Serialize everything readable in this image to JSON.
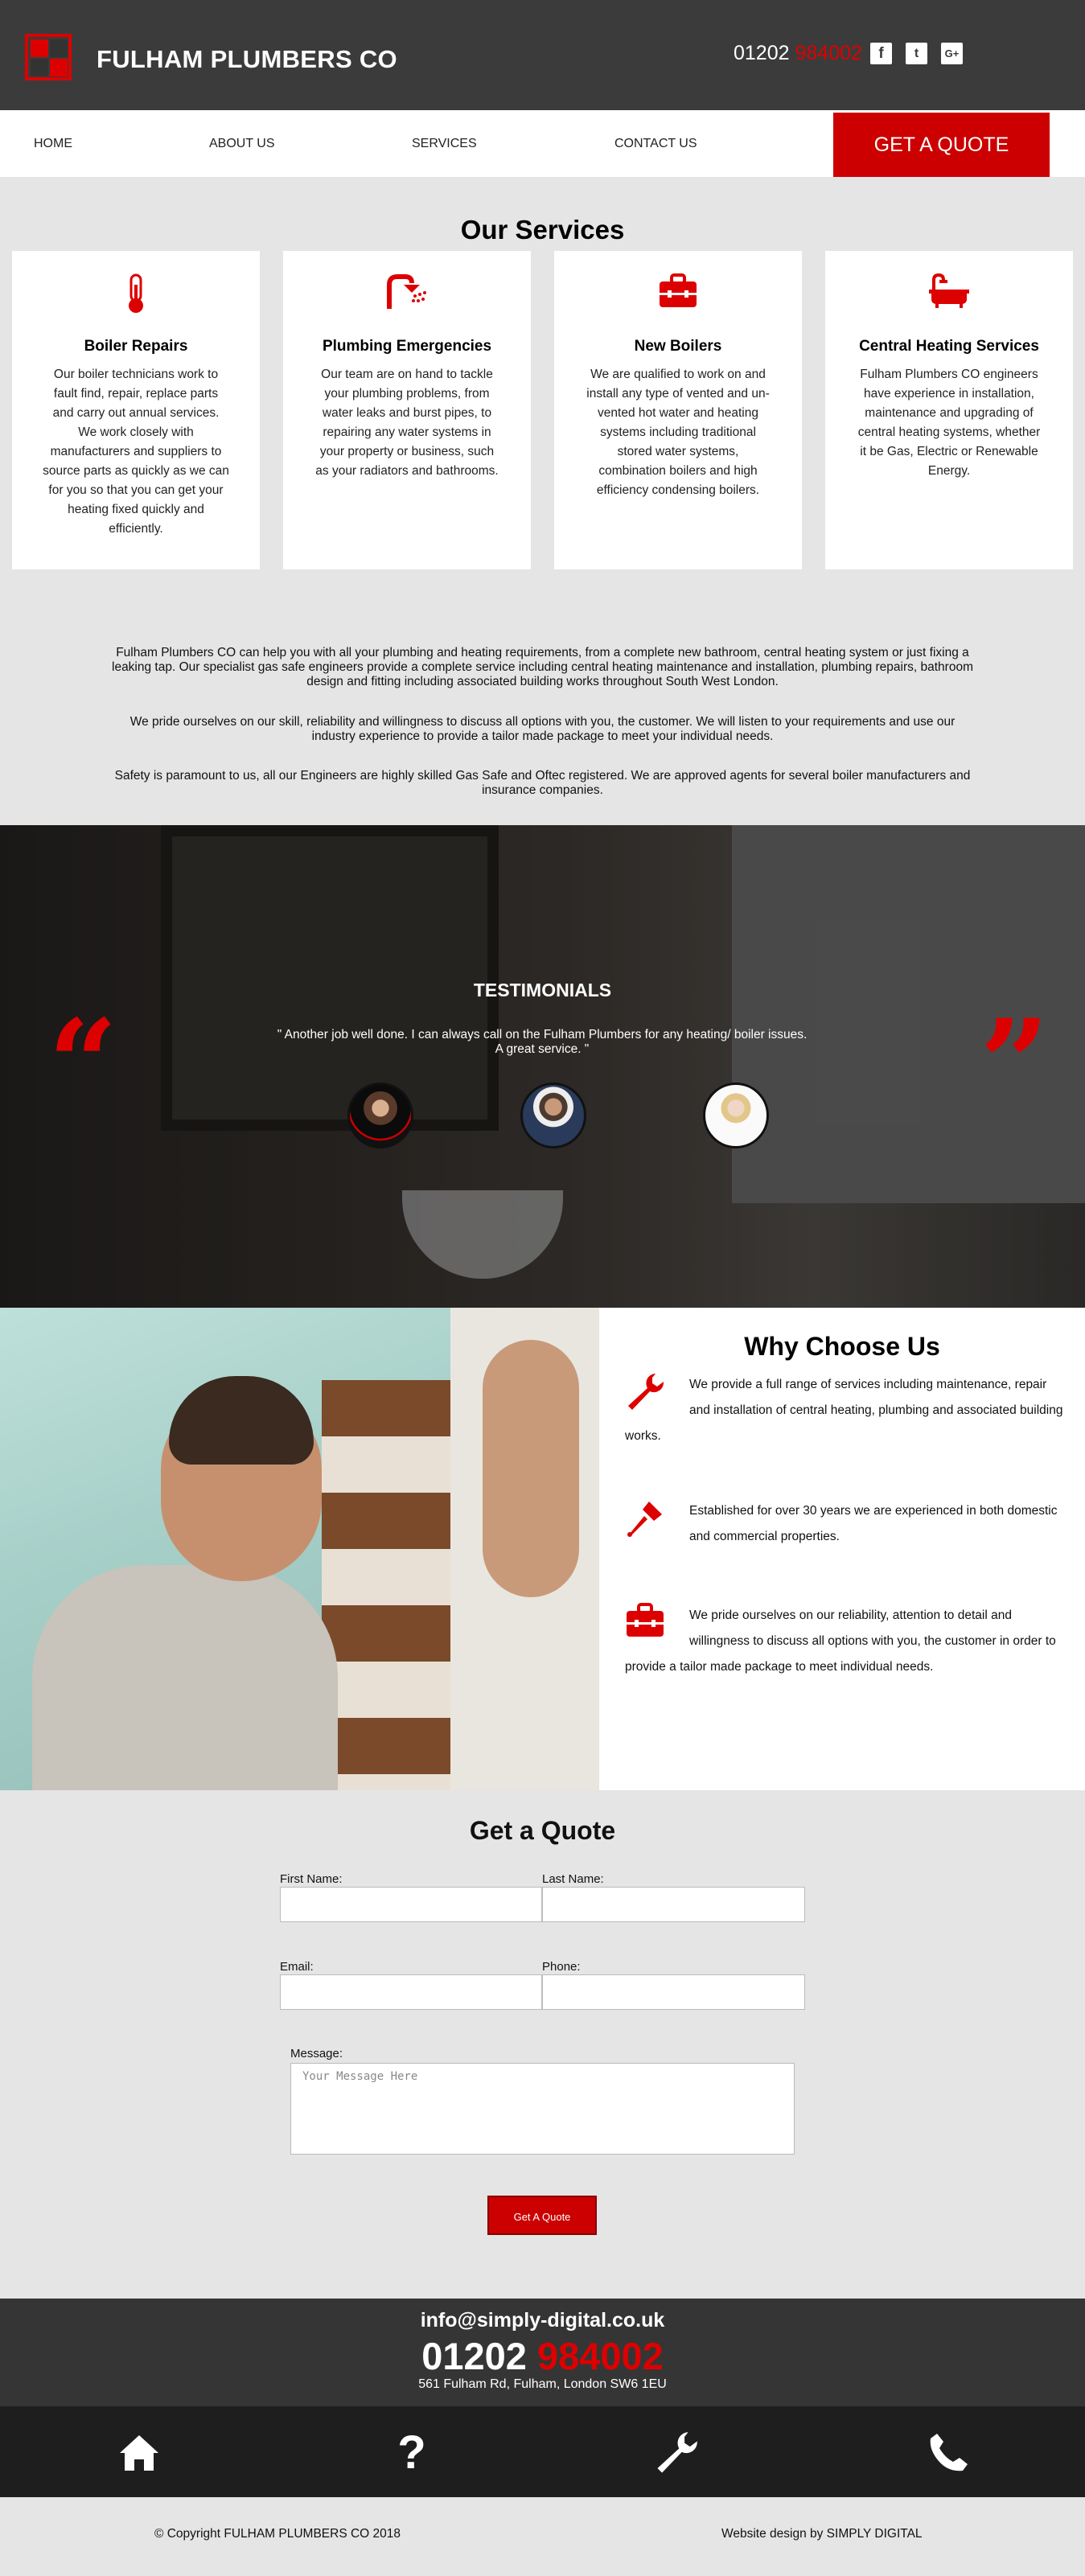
{
  "brand": {
    "name": "FULHAM PLUMBERS CO"
  },
  "header": {
    "phone_prefix": "01202",
    "phone_suffix": "984002",
    "social": [
      {
        "icon": "facebook-icon",
        "glyph": "f"
      },
      {
        "icon": "twitter-icon",
        "glyph": "t"
      },
      {
        "icon": "google-plus-icon",
        "glyph": "G+"
      }
    ]
  },
  "nav": {
    "items": [
      "HOME",
      "ABOUT US",
      "SERVICES",
      "CONTACT US"
    ],
    "cta": "GET A QUOTE"
  },
  "services": {
    "title": "Our Services",
    "cards": [
      {
        "icon": "thermometer-icon",
        "title": "Boiler Repairs",
        "text": "Our boiler technicians work to fault find, repair, replace parts and carry out annual services. We work closely with manufacturers and suppliers to source parts as quickly as we can for you so that you can get your heating fixed quickly and efficiently."
      },
      {
        "icon": "shower-icon",
        "title": "Plumbing Emergencies",
        "text": "Our team are on hand to tackle your plumbing problems, from water leaks and burst pipes, to repairing any water systems in your property or business, such as your radiators and bathrooms."
      },
      {
        "icon": "toolbox-icon",
        "title": "New Boilers",
        "text": "We are qualified to work on and install any type of vented and un-vented hot water and heating systems including traditional stored water systems, combination boilers and high efficiency condensing boilers."
      },
      {
        "icon": "bathtub-icon",
        "title": "Central Heating Services",
        "text": "Fulham Plumbers CO engineers have experience in installation, maintenance and upgrading of central heating systems, whether it be Gas, Electric or Renewable Energy."
      }
    ]
  },
  "intro": [
    "Fulham Plumbers CO can help you with all your plumbing and heating requirements, from a complete new bathroom, central heating system or just fixing a leaking tap. Our specialist gas safe engineers provide a complete service including central heating maintenance and installation, plumbing repairs, bathroom design and fitting including associated building works throughout South West London.",
    "We pride ourselves on our skill, reliability and willingness to discuss all options with you, the customer. We will listen to your requirements and use our industry experience to provide a tailor made package to meet your individual needs.",
    "Safety is paramount to us, all our Engineers are highly skilled Gas Safe and Oftec registered. We are approved agents for several boiler manufacturers and insurance companies."
  ],
  "testimonials": {
    "title": "TESTIMONIALS",
    "quote": "\" Another job well done. I can always call on the Fulham Plumbers for any heating/ boiler issues. A great service. \"",
    "avatars": [
      "avatar-woman-dark",
      "avatar-man-beard",
      "avatar-woman-blonde"
    ]
  },
  "why": {
    "title": "Why Choose Us",
    "items": [
      {
        "icon": "wrench-icon",
        "text": "We provide a full range of services including maintenance, repair and installation of central heating, plumbing and associated building works."
      },
      {
        "icon": "screwdriver-icon",
        "text": "Established for over 30 years we are experienced in both domestic and commercial properties."
      },
      {
        "icon": "toolbox-icon",
        "text": "We pride ourselves on our reliability, attention to detail and willingness to discuss all options with you, the customer in order to provide a tailor made package to meet individual needs."
      }
    ]
  },
  "form": {
    "title": "Get a Quote",
    "first_name_label": "First Name:",
    "last_name_label": "Last Name:",
    "email_label": "Email:",
    "phone_label": "Phone:",
    "message_label": "Message:",
    "message_placeholder": "Your Message Here",
    "submit_label": "Get A Quote"
  },
  "footer": {
    "email": "info@simply-digital.co.uk",
    "phone_prefix": "01202",
    "phone_suffix": "984002",
    "address": "561 Fulham Rd, Fulham, London SW6 1EU",
    "icons": [
      "home-icon",
      "question-icon",
      "wrench-icon",
      "phone-icon"
    ],
    "copyright": "© Copyright FULHAM PLUMBERS CO 2018",
    "credit": "Website design by SIMPLY DIGITAL"
  },
  "colors": {
    "accent": "#cc0000",
    "dark": "#3b3b3b",
    "footer_dark": "#1e1e1e",
    "background": "#e5e5e5"
  }
}
